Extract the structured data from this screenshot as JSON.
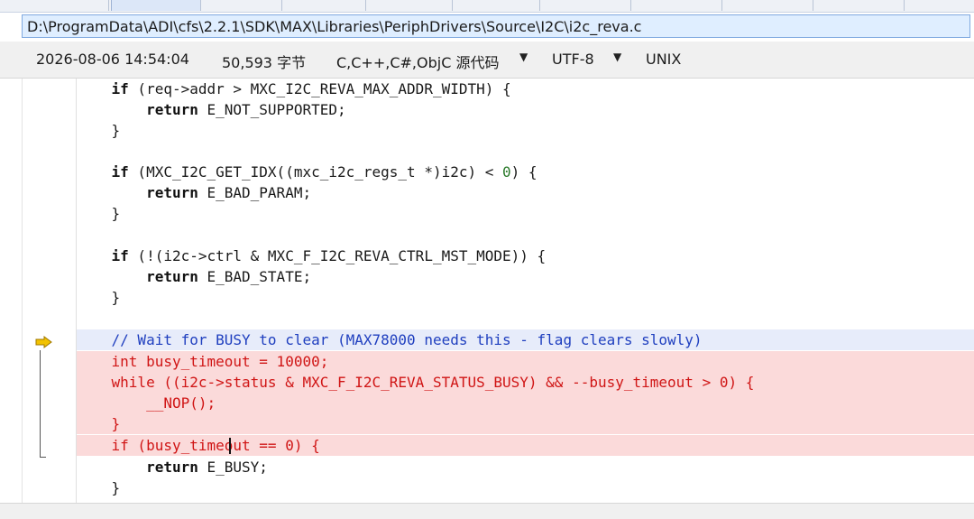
{
  "path": "D:\\ProgramData\\ADI\\cfs\\2.2.1\\SDK\\MAX\\Libraries\\PeriphDrivers\\Source\\I2C\\i2c_reva.c",
  "info": {
    "datetime": "2026-08-06 14:54:04",
    "size": "50,593 字节",
    "language": "C,C++,C#,ObjC 源代码",
    "encoding": "UTF-8",
    "line_ending": "UNIX"
  },
  "icons": {
    "caret": "▼"
  },
  "code": {
    "l1": {
      "kw": "if",
      "rest": " (req->addr > MXC_I2C_REVA_MAX_ADDR_WIDTH) {"
    },
    "l2": {
      "kw": "return",
      "rest": " E_NOT_SUPPORTED;"
    },
    "l3": {
      "rest": "}"
    },
    "l5": {
      "kw": "if",
      "rest": " (MXC_I2C_GET_IDX((mxc_i2c_regs_t *)i2c) < ",
      "num": "0",
      "tail": ") {"
    },
    "l6": {
      "kw": "return",
      "rest": " E_BAD_PARAM;"
    },
    "l7": {
      "rest": "}"
    },
    "l9": {
      "kw": "if",
      "rest": " (!(i2c->ctrl & MXC_F_I2C_REVA_CTRL_MST_MODE)) {"
    },
    "l10": {
      "kw": "return",
      "rest": " E_BAD_STATE;"
    },
    "l11": {
      "rest": "}"
    },
    "l13": {
      "comment": "// Wait for BUSY to clear (MAX78000 needs this - flag clears slowly)"
    },
    "l14": {
      "text": "int busy_timeout = 10000;"
    },
    "l15": {
      "text": "while ((i2c->status & MXC_F_I2C_REVA_STATUS_BUSY) && --busy_timeout > 0) {"
    },
    "l16": {
      "text": "__NOP();"
    },
    "l17": {
      "text": "}"
    },
    "l18": {
      "text": "if (busy_timeout == 0) {"
    },
    "l19": {
      "kw": "return",
      "rest": " E_BUSY;"
    },
    "l20": {
      "rest": "}"
    }
  }
}
